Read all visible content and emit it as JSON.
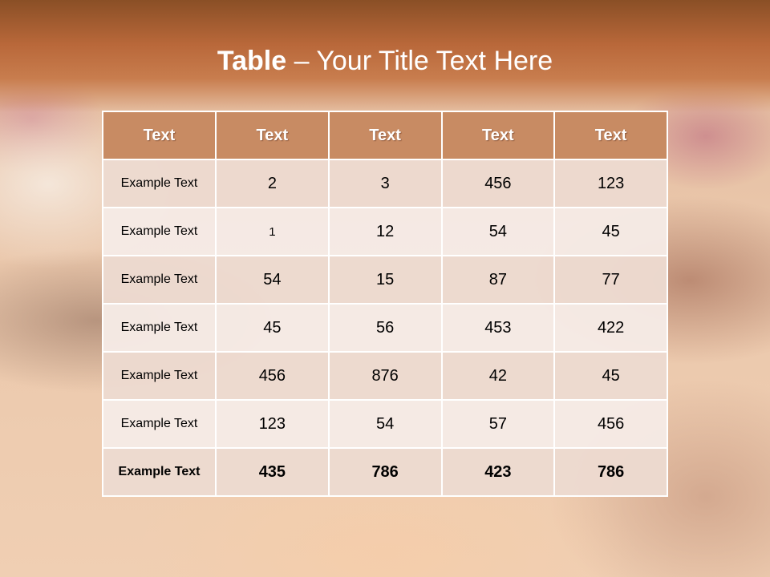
{
  "slide": {
    "title_bold": "Table",
    "title_rest": " – Your Title Text Here"
  },
  "table": {
    "headers": [
      "Text",
      "Text",
      "Text",
      "Text",
      "Text"
    ],
    "rows": [
      [
        "Example Text",
        "2",
        "3",
        "456",
        "123"
      ],
      [
        "Example Text",
        "1",
        "12",
        "54",
        "45"
      ],
      [
        "Example Text",
        "54",
        "15",
        "87",
        "77"
      ],
      [
        "Example Text",
        "45",
        "56",
        "453",
        "422"
      ],
      [
        "Example Text",
        "456",
        "876",
        "42",
        "45"
      ],
      [
        "Example Text",
        "123",
        "54",
        "57",
        "456"
      ],
      [
        "Example Text",
        "435",
        "786",
        "423",
        "786"
      ]
    ]
  },
  "colors": {
    "title_bar": "#b9683a",
    "header_fill": "#c88b63",
    "row_odd": "#ecdad0",
    "row_even": "#f5eae5"
  }
}
